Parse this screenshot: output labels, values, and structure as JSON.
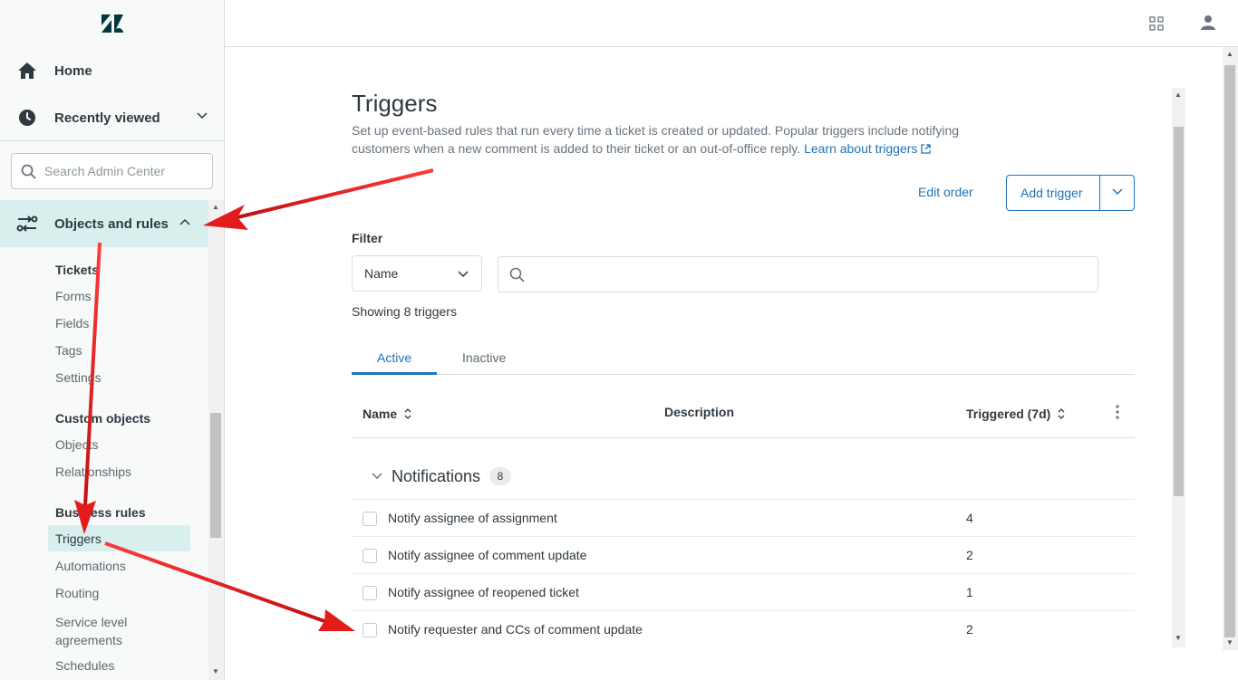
{
  "sidebar": {
    "home_label": "Home",
    "recent_label": "Recently viewed",
    "search_placeholder": "Search Admin Center",
    "section_label": "Objects and rules",
    "groups": [
      {
        "heading": "Tickets",
        "items": [
          "Forms",
          "Fields",
          "Tags",
          "Settings"
        ]
      },
      {
        "heading": "Custom objects",
        "items": [
          "Objects",
          "Relationships"
        ]
      },
      {
        "heading": "Business rules",
        "items": [
          "Triggers",
          "Automations",
          "Routing",
          "Service level agreements",
          "Schedules"
        ]
      }
    ]
  },
  "page": {
    "title": "Triggers",
    "description": "Set up event-based rules that run every time a ticket is created or updated. Popular triggers include notifying customers when a new comment is added to their ticket or an out-of-office reply.",
    "learn_link": "Learn about triggers",
    "edit_order": "Edit order",
    "add_trigger": "Add trigger",
    "filter_label": "Filter",
    "filter_select": "Name",
    "showing": "Showing 8 triggers",
    "tabs": [
      "Active",
      "Inactive"
    ],
    "columns": {
      "name": "Name",
      "description": "Description",
      "triggered": "Triggered (7d)"
    },
    "group": {
      "label": "Notifications",
      "count": "8"
    },
    "rows": [
      {
        "name": "Notify assignee of assignment",
        "count": "4"
      },
      {
        "name": "Notify assignee of comment update",
        "count": "2"
      },
      {
        "name": "Notify assignee of reopened ticket",
        "count": "1"
      },
      {
        "name": "Notify requester and CCs of comment update",
        "count": "2"
      }
    ]
  },
  "colors": {
    "accent": "#1f73b7",
    "highlight": "#d9efee",
    "arrow": "#e41b1b"
  }
}
